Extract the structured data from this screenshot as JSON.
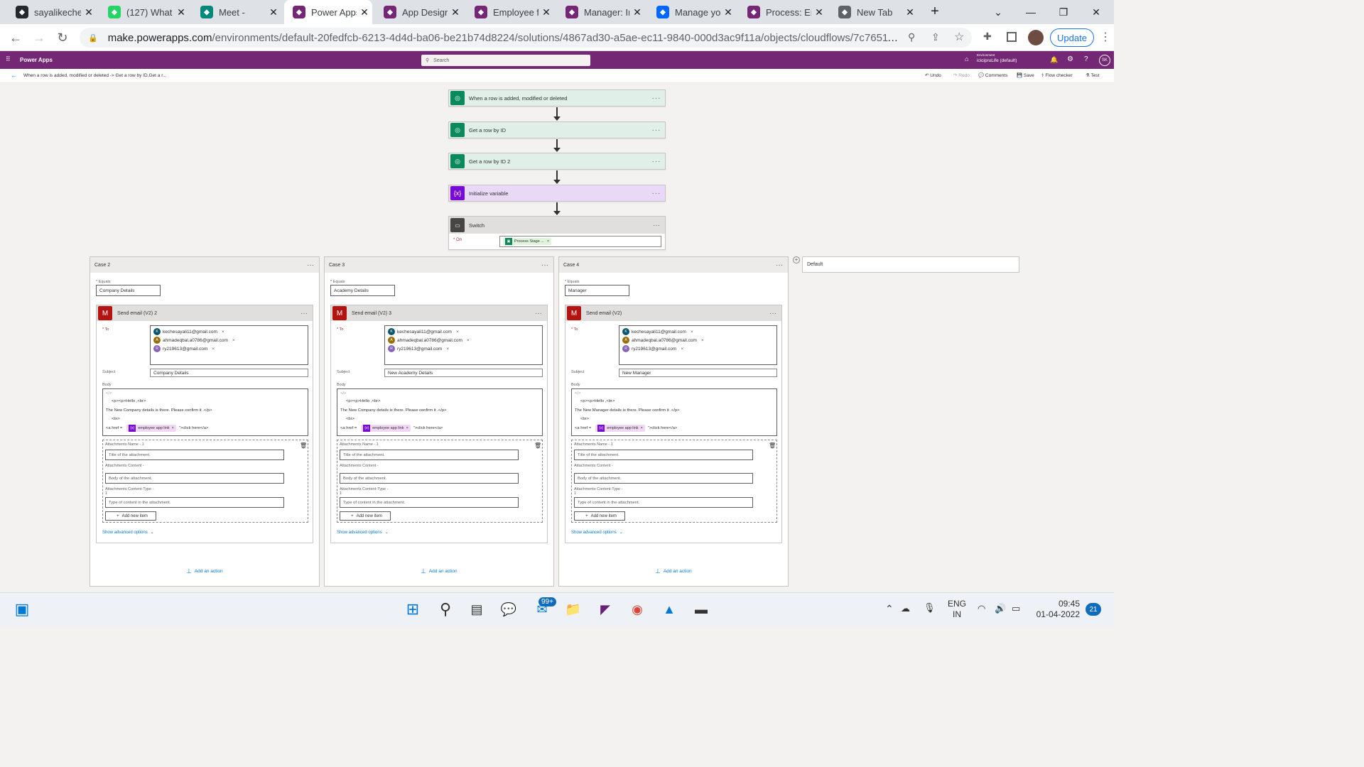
{
  "browser": {
    "tabs": [
      {
        "label": "sayalikeche",
        "icon": "github-icon",
        "color": "#24292e"
      },
      {
        "label": "(127) What",
        "icon": "whatsapp-icon",
        "color": "#25d366"
      },
      {
        "label": "Meet -",
        "icon": "meet-icon",
        "color": "#00897b"
      },
      {
        "label": "Power Apps",
        "icon": "powerapps-icon",
        "color": "#742774"
      },
      {
        "label": "App Design",
        "icon": "powerapps-design-icon",
        "color": "#742774"
      },
      {
        "label": "Employee fi",
        "icon": "powerapps-icon",
        "color": "#742774"
      },
      {
        "label": "Manager: Ir",
        "icon": "powerapps-icon",
        "color": "#742774"
      },
      {
        "label": "Manage yo",
        "icon": "power-automate-icon",
        "color": "#0066ff"
      },
      {
        "label": "Process: En",
        "icon": "powerapps-design-icon",
        "color": "#742774"
      },
      {
        "label": "New Tab",
        "icon": "chrome-icon",
        "color": "#5f6368"
      }
    ],
    "url_domain": "make.powerapps.com",
    "url_path": "/environments/default-20fedfcb-6213-4d4d-ba06-be21b74d8224/solutions/4867ad30-a5ae-ec11-9840-000d3ac9f11a/objects/cloudflows/7c765119-5711...",
    "update_label": "Update"
  },
  "app": {
    "name": "Power Apps",
    "search_placeholder": "Search",
    "env_label": "Environment",
    "env_name": "icicipruLife (default)",
    "avatar": "SK",
    "accent": "#742774"
  },
  "commandbar": {
    "breadcrumb": "When a row is added, modified or deleted -> Get a row by ID,Get a r...",
    "undo": "Undo",
    "redo": "Redo",
    "comments": "Comments",
    "save": "Save",
    "flow_checker": "Flow checker",
    "test": "Test"
  },
  "flow": {
    "steps": [
      {
        "label": "When a row is added, modified or deleted",
        "color": "#0a8a5b",
        "bg": "#e0f0e9"
      },
      {
        "label": "Get a row by ID",
        "color": "#0a8a5b",
        "bg": "#e0f0e9"
      },
      {
        "label": "Get a row by ID 2",
        "color": "#0a8a5b",
        "bg": "#e0f0e9"
      },
      {
        "label": "Initialize variable",
        "color": "#770bd6",
        "bg": "#ead9f6"
      }
    ],
    "switch": {
      "label": "Switch",
      "on_label": "* On",
      "on_token": "Process Stage ..."
    },
    "cases": [
      {
        "title": "Case 2",
        "equals_label": "* Equals",
        "equals_value": "Company Details",
        "action_title": "Send email (V2) 2",
        "to_label": "* To",
        "recipients": [
          "kechesayali11@gmail.com",
          "ahmadeqbal.a0786@gmail.com",
          "ry219613@gmail.com"
        ],
        "subject_label": "Subject",
        "subject": "Company Details",
        "body_label": "Body",
        "body_line1": "<p><p>Hello ,<br>",
        "body_line2": "The New Company  details is there. Please confirm it .</p>",
        "body_line3": "<br>",
        "body_href": "<a href =",
        "token": "employee app link",
        "body_tail": "\">click here</a>",
        "add_action": "Add an action"
      },
      {
        "title": "Case 3",
        "equals_label": "* Equals",
        "equals_value": "Academy Details",
        "action_title": "Send email (V2) 3",
        "to_label": "* To",
        "recipients": [
          "kechesayali11@gmail.com",
          "ahmadeqbal.a0786@gmail.com",
          "ry219613@gmail.com"
        ],
        "subject_label": "Subject",
        "subject": "New Academy Details",
        "body_label": "Body",
        "body_line1": "<p><p>Hello ,<br>",
        "body_line2": "The New Company  details is there. Please confirm it .</p>",
        "body_line3": "<br>",
        "body_href": "<a href =",
        "token": "employee app link",
        "body_tail": "\">click here</a>",
        "add_action": "Add an action"
      },
      {
        "title": "Case 4",
        "equals_label": "* Equals",
        "equals_value": "Manager",
        "action_title": "Send email (V2)",
        "to_label": "* To",
        "recipients": [
          "kechesayali11@gmail.com",
          "ahmadeqbal.a0786@gmail.com",
          "ry219613@gmail.com"
        ],
        "subject_label": "Subject",
        "subject": "New Manager",
        "body_label": "Body",
        "body_line1": "<p><p>Hello ,<br>",
        "body_line2": "The New Manager details is there. Please confirm it .</p>",
        "body_line3": "<br>",
        "body_href": "<a href =",
        "token": "employee app link",
        "body_tail": "\">click here</a>",
        "add_action": "Add an action"
      }
    ],
    "attachments": {
      "name_label": "Attachments Name - 1",
      "name_placeholder": "Title of the attachment.",
      "content_label": "Attachments Content -",
      "content_placeholder": "Body of the attachment.",
      "type_label": "Attachments Content-Type - 1",
      "type_placeholder": "Type of content in the attachment.",
      "add_new_item": "Add new item",
      "show_advanced": "Show advanced options"
    },
    "default_label": "Default"
  },
  "taskbar": {
    "badge_mail": "99+",
    "lang": "ENG",
    "region": "IN",
    "time": "09:45",
    "date": "01-04-2022",
    "notif_count": "21"
  }
}
